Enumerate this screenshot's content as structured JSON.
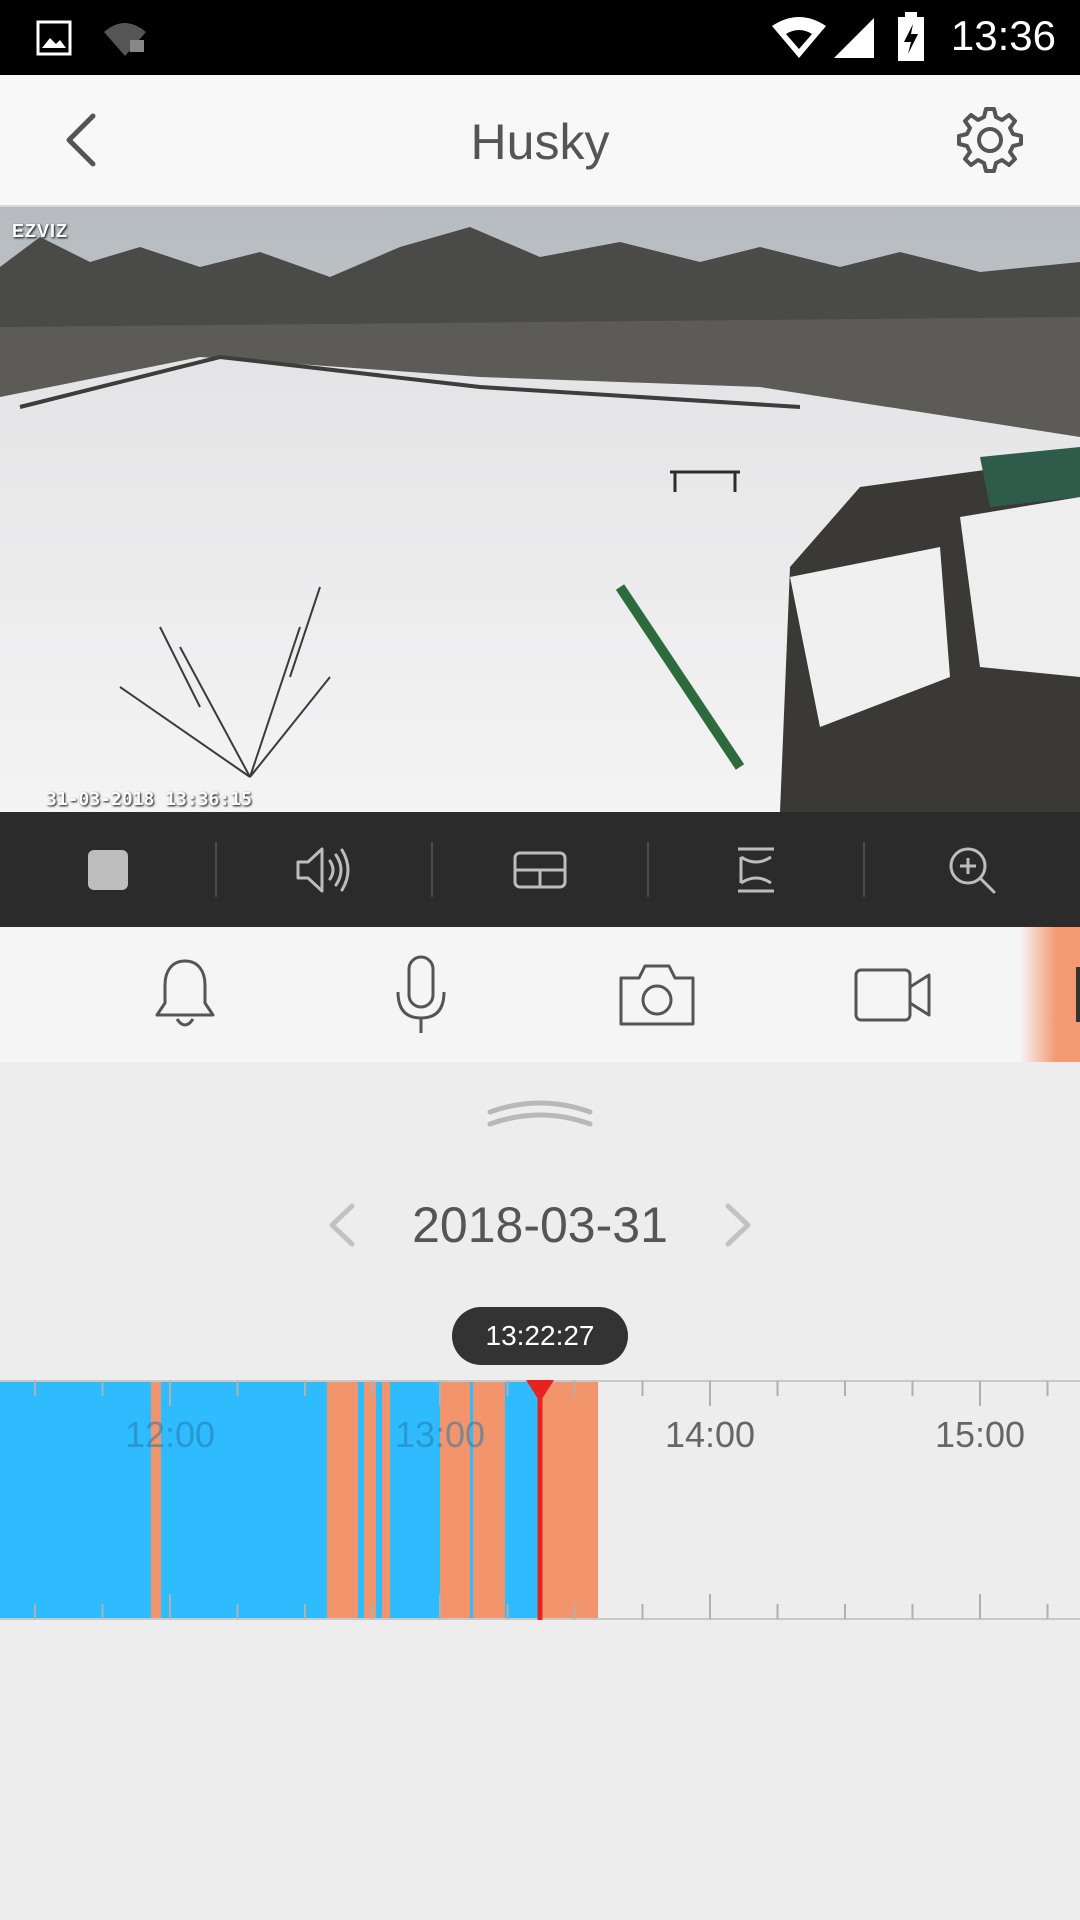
{
  "status_bar": {
    "time": "13:36"
  },
  "header": {
    "title": "Husky"
  },
  "video": {
    "brand": "EZVIZ",
    "osd_timestamp": "31-03-2018 13:36:15"
  },
  "playback": {
    "date": "2018-03-31",
    "current_time": "13:22:27",
    "time_labels": [
      "12:00",
      "13:00",
      "14:00",
      "15:00"
    ]
  },
  "colors": {
    "continuous": "#2ebcff",
    "event": "#f2946c",
    "cursor": "#e8231f"
  }
}
